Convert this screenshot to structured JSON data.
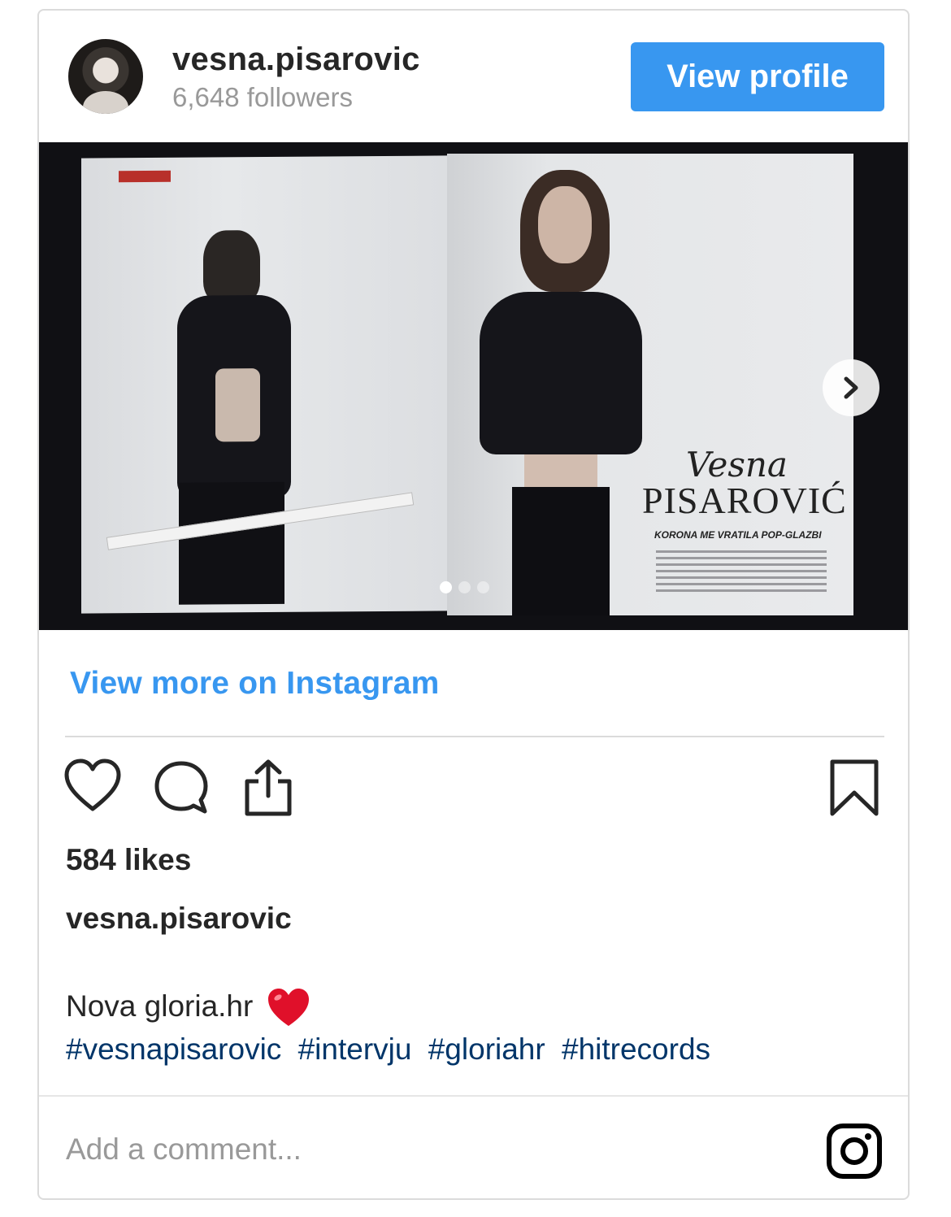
{
  "header": {
    "username": "vesna.pisarovic",
    "followers": "6,648 followers",
    "view_profile_label": "View profile"
  },
  "media": {
    "magazine_first_name": "Vesna",
    "magazine_last_name": "PISAROVIĆ",
    "magazine_subtitle": "KORONA ME VRATILA POP-GLAZBI",
    "carousel_total": 3,
    "carousel_active": 1
  },
  "links": {
    "view_more": "View more on Instagram"
  },
  "post": {
    "likes": "584 likes",
    "caption_user": "vesna.pisarovic",
    "caption_text": "Nova gloria.hr",
    "caption_emoji": "red-heart",
    "hashtags": [
      "#vesnapisarovic",
      "#intervju",
      "#gloriahr",
      "#hitrecords"
    ]
  },
  "footer": {
    "comment_placeholder": "Add a comment..."
  },
  "colors": {
    "accent": "#3897f0",
    "hashtag": "#003569",
    "text": "#262626",
    "muted": "#999999"
  },
  "icons": [
    "heart-icon",
    "comment-icon",
    "share-icon",
    "bookmark-icon",
    "chevron-right-icon",
    "instagram-icon"
  ]
}
